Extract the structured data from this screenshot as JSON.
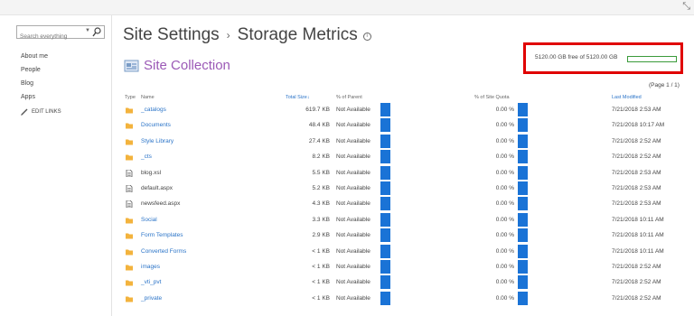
{
  "search": {
    "placeholder": "Search everything"
  },
  "leftnav": {
    "items": [
      "About me",
      "People",
      "Blog",
      "Apps"
    ],
    "edit_links": "EDIT LINKS"
  },
  "breadcrumb": {
    "parent": "Site Settings",
    "separator": "›",
    "current": "Storage Metrics",
    "info_icon": "ⓘ"
  },
  "collection": {
    "title": "Site Collection",
    "icon": "site-collection-icon"
  },
  "quota": {
    "text": "5120.00 GB free of 5120.00 GB",
    "free_fraction": 1.0,
    "bar_color": "#3a9b3a"
  },
  "pagination": {
    "text": "(Page 1 / 1)"
  },
  "table": {
    "columns": {
      "type": "Type",
      "name": "Name",
      "total_size": "Total Size",
      "sort_indicator": "↓",
      "percent_parent": "% of Parent",
      "percent_quota": "% of Site Quota",
      "last_modified": "Last Modified"
    },
    "rows": [
      {
        "type": "folder",
        "name": "_catalogs",
        "size": "619.7 KB",
        "parent": "Not Available",
        "quota": "0.00 %",
        "modified": "7/21/2018 2:53 AM"
      },
      {
        "type": "folder",
        "name": "Documents",
        "size": "48.4 KB",
        "parent": "Not Available",
        "quota": "0.00 %",
        "modified": "7/21/2018 10:17 AM"
      },
      {
        "type": "folder",
        "name": "Style Library",
        "size": "27.4 KB",
        "parent": "Not Available",
        "quota": "0.00 %",
        "modified": "7/21/2018 2:52 AM"
      },
      {
        "type": "folder",
        "name": "_cts",
        "size": "8.2 KB",
        "parent": "Not Available",
        "quota": "0.00 %",
        "modified": "7/21/2018 2:52 AM"
      },
      {
        "type": "file",
        "name": "blog.xsl",
        "size": "5.5 KB",
        "parent": "Not Available",
        "quota": "0.00 %",
        "modified": "7/21/2018 2:53 AM"
      },
      {
        "type": "file",
        "name": "default.aspx",
        "size": "5.2 KB",
        "parent": "Not Available",
        "quota": "0.00 %",
        "modified": "7/21/2018 2:53 AM"
      },
      {
        "type": "file",
        "name": "newsfeed.aspx",
        "size": "4.3 KB",
        "parent": "Not Available",
        "quota": "0.00 %",
        "modified": "7/21/2018 2:53 AM"
      },
      {
        "type": "folder",
        "name": "Social",
        "size": "3.3 KB",
        "parent": "Not Available",
        "quota": "0.00 %",
        "modified": "7/21/2018 10:11 AM"
      },
      {
        "type": "folder",
        "name": "Form Templates",
        "size": "2.9 KB",
        "parent": "Not Available",
        "quota": "0.00 %",
        "modified": "7/21/2018 10:11 AM"
      },
      {
        "type": "folder",
        "name": "Converted Forms",
        "size": "< 1 KB",
        "parent": "Not Available",
        "quota": "0.00 %",
        "modified": "7/21/2018 10:11 AM"
      },
      {
        "type": "folder",
        "name": "images",
        "size": "< 1 KB",
        "parent": "Not Available",
        "quota": "0.00 %",
        "modified": "7/21/2018 2:52 AM"
      },
      {
        "type": "folder",
        "name": "_vti_pvt",
        "size": "< 1 KB",
        "parent": "Not Available",
        "quota": "0.00 %",
        "modified": "7/21/2018 2:52 AM"
      },
      {
        "type": "folder",
        "name": "_private",
        "size": "< 1 KB",
        "parent": "Not Available",
        "quota": "0.00 %",
        "modified": "7/21/2018 2:52 AM"
      }
    ]
  },
  "colors": {
    "accent": "#2b74c8",
    "title_purple": "#9b59b6",
    "bar_blue": "#1a73d6",
    "highlight_red": "#e00000",
    "folder": "#f3b33d"
  }
}
